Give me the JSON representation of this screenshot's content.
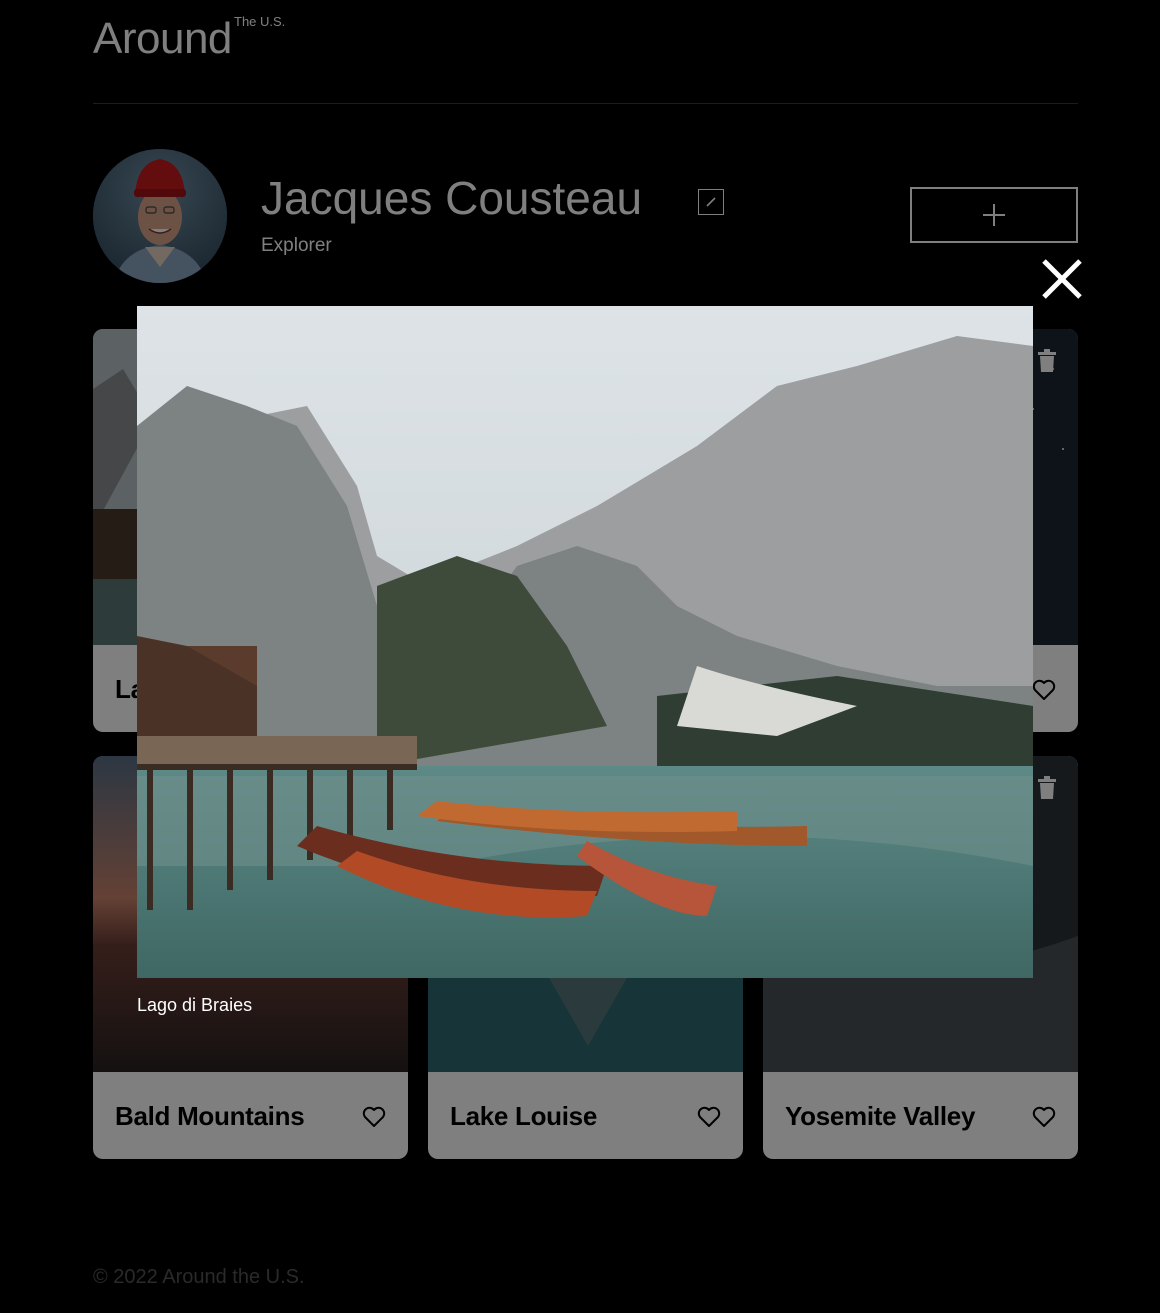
{
  "header": {
    "logo_main": "Around",
    "logo_sup": "The U.S."
  },
  "profile": {
    "name": "Jacques Cousteau",
    "job": "Explorer"
  },
  "cards": [
    {
      "title": "La"
    },
    {
      "title": ""
    },
    {
      "title": ""
    },
    {
      "title": "Bald Mountains"
    },
    {
      "title": "Lake Louise"
    },
    {
      "title": "Yosemite Valley"
    }
  ],
  "popup": {
    "caption": "Lago di Braies"
  },
  "footer": {
    "copyright": "© 2022 Around the U.S."
  },
  "colors": {
    "background": "#000000",
    "card": "#ffffff",
    "footer_text": "#545454",
    "overlay": "rgba(0,0,0,0.5)"
  },
  "icons": [
    "edit-icon",
    "plus-icon",
    "close-icon",
    "trash-icon",
    "heart-icon"
  ]
}
